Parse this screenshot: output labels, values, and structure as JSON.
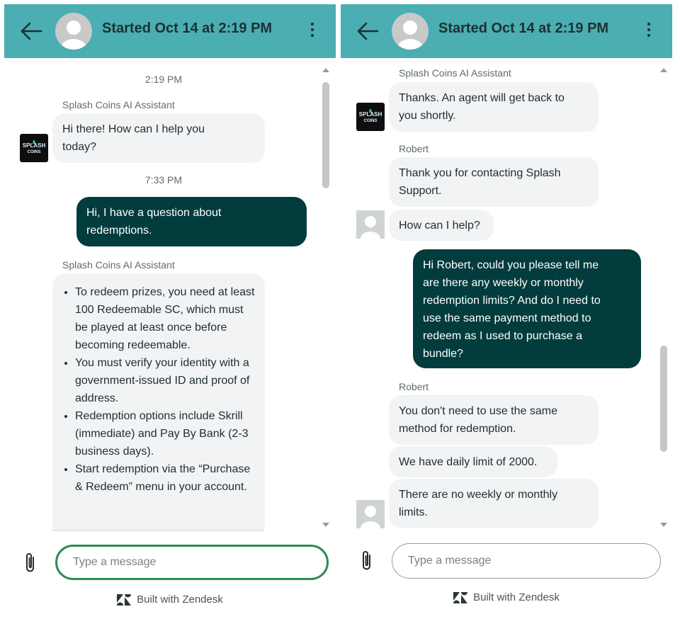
{
  "left": {
    "header": {
      "title": "Started Oct 14 at 2:19 PM"
    },
    "messages": {
      "time1": "2:19 PM",
      "sender1": "Splash Coins AI Assistant",
      "bot1_line1": "Hi there! How can I help you",
      "bot1_line2": "today?",
      "time2": "7:33 PM",
      "user1_line1": "Hi, I have a question about",
      "user1_line2": "redemptions.",
      "sender2": "Splash Coins AI Assistant",
      "bullets": [
        "To redeem prizes, you need at least 100 Redeemable SC, which must be played at least once before becoming redeemable.",
        "You must verify your identity with a government-issued ID and proof of address.",
        "Redemption options include Skrill (immediate) and Pay By Bank (2-3 business days).",
        "Start redemption via the “Purchase & Redeem” menu in your account."
      ]
    },
    "composer": {
      "placeholder": "Type a message"
    },
    "branding": "Built with Zendesk"
  },
  "right": {
    "header": {
      "title": "Started Oct 14 at 2:19 PM"
    },
    "messages": {
      "sender1": "Splash Coins AI Assistant",
      "bot1_line1": "Thanks. An agent will get back to",
      "bot1_line2": "you shortly.",
      "sender2": "Robert",
      "agent1_line1": "Thank you for contacting Splash",
      "agent1_line2": "Support.",
      "agent2": "How can I help?",
      "user1_lines": [
        "Hi Robert, could you please tell me",
        "are there any weekly or monthly",
        "redemption limits? And do I need to",
        "use the same payment method to",
        "redeem as I used to purchase a",
        "bundle?"
      ],
      "sender3": "Robert",
      "agent3_line1": "You don't need to use the same",
      "agent3_line2": "method for redemption.",
      "agent4": "We have daily limit of 2000.",
      "agent5_line1": "There are no weekly or monthly",
      "agent5_line2": "limits."
    },
    "composer": {
      "placeholder": "Type a message"
    },
    "branding": "Built with Zendesk"
  },
  "logo": {
    "line1": "SPLASH",
    "line2": "COINS"
  },
  "colors": {
    "header": "#4aaeb3",
    "dark_bubble": "#033c3c",
    "light_bubble": "#f2f3f5",
    "focus_border": "#2e8b57"
  }
}
